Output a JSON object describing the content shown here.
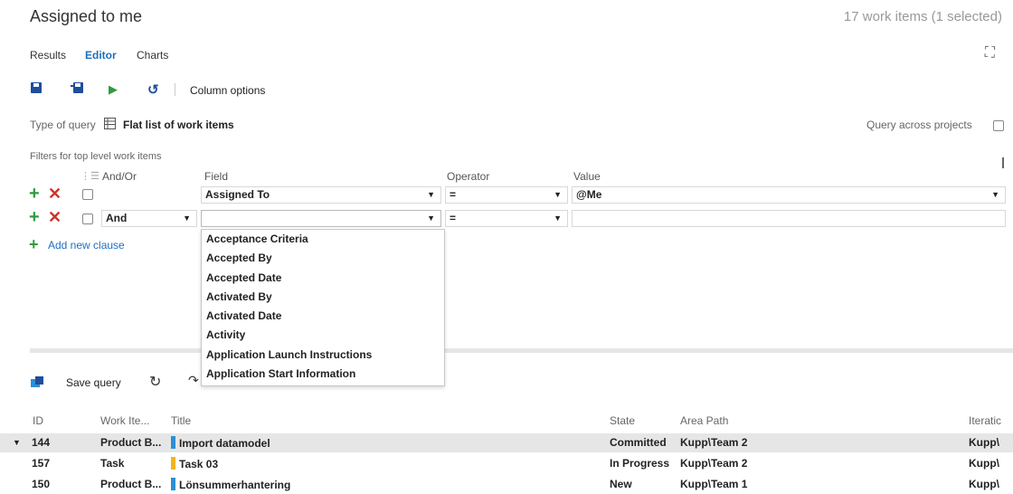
{
  "header": {
    "title": "Assigned to me",
    "count": "17 work items (1 selected)"
  },
  "tabs": [
    "Results",
    "Editor",
    "Charts"
  ],
  "toolbar": {
    "column_options": "Column options"
  },
  "query_type": {
    "label": "Type of query",
    "value": "Flat list of work items",
    "across_projects": "Query across projects"
  },
  "filters": {
    "title": "Filters for top level work items",
    "headers": {
      "andor": "And/Or",
      "field": "Field",
      "operator": "Operator",
      "value": "Value"
    },
    "rows": [
      {
        "andor": "",
        "field": "Assigned To",
        "operator": "=",
        "value": "@Me"
      },
      {
        "andor": "And",
        "field": "",
        "operator": "=",
        "value": ""
      }
    ],
    "add_clause": "Add new clause"
  },
  "field_options": [
    "Acceptance Criteria",
    "Accepted By",
    "Accepted Date",
    "Activated By",
    "Activated Date",
    "Activity",
    "Application Launch Instructions",
    "Application Start Information"
  ],
  "results_toolbar": {
    "save_query": "Save query"
  },
  "grid": {
    "columns": [
      "ID",
      "Work Ite...",
      "Title",
      "State",
      "Area Path",
      "Iteratic"
    ],
    "rows": [
      {
        "id": "144",
        "type": "Product B...",
        "title": "Import datamodel",
        "state": "Committed",
        "area": "Kupp\\Team 2",
        "iteration": "Kupp\\",
        "color": "#2b8fd6",
        "selected": true
      },
      {
        "id": "157",
        "type": "Task",
        "title": "Task 03",
        "state": "In Progress",
        "area": "Kupp\\Team 2",
        "iteration": "Kupp\\",
        "color": "#f2b51d",
        "selected": false
      },
      {
        "id": "150",
        "type": "Product B...",
        "title": "Lönsummerhantering",
        "state": "New",
        "area": "Kupp\\Team 1",
        "iteration": "Kupp\\",
        "color": "#2b8fd6",
        "selected": false
      }
    ]
  },
  "colors": {
    "accent": "#1f6fbf",
    "add": "#2e9b3e",
    "remove": "#d0322a",
    "selected_row": "#e6e6e6"
  }
}
